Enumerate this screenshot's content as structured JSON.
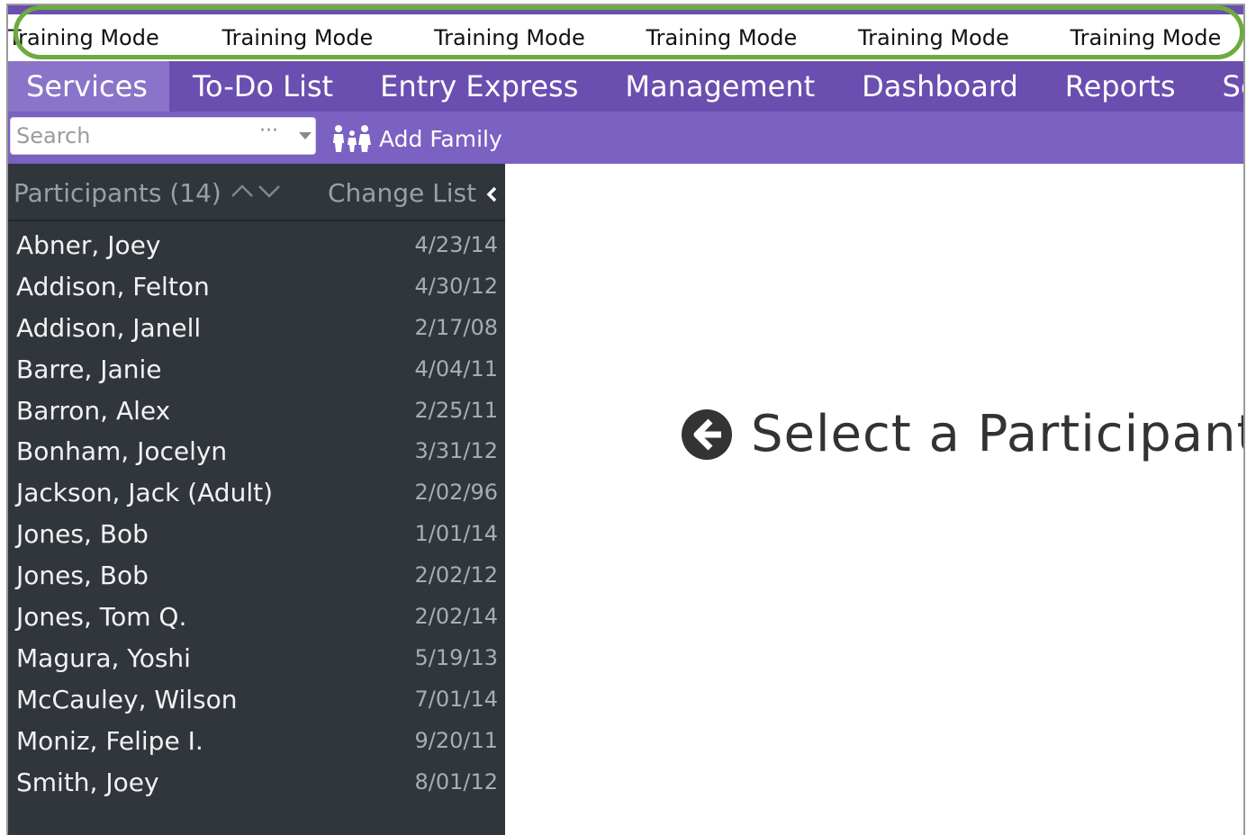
{
  "training_bar": {
    "items": [
      "Training Mode",
      "Training Mode",
      "Training Mode",
      "Training Mode",
      "Training Mode",
      "Training Mode"
    ],
    "highlight_color": "#6cab3c"
  },
  "nav": {
    "tabs": [
      {
        "label": "Services",
        "active": true
      },
      {
        "label": "To-Do List",
        "active": false
      },
      {
        "label": "Entry Express",
        "active": false
      },
      {
        "label": "Management",
        "active": false
      },
      {
        "label": "Dashboard",
        "active": false
      },
      {
        "label": "Reports",
        "active": false
      },
      {
        "label": "Setup",
        "active": false
      }
    ]
  },
  "toolbar": {
    "search_placeholder": "Search",
    "search_dots": "···",
    "add_family_label": "Add Family"
  },
  "sidebar": {
    "participants_label": "Participants (14)",
    "change_list_label": "Change List",
    "participants": [
      {
        "name": "Abner, Joey",
        "date": "4/23/14"
      },
      {
        "name": "Addison, Felton",
        "date": "4/30/12"
      },
      {
        "name": "Addison, Janell",
        "date": "2/17/08"
      },
      {
        "name": "Barre, Janie",
        "date": "4/04/11"
      },
      {
        "name": "Barron, Alex",
        "date": "2/25/11"
      },
      {
        "name": "Bonham, Jocelyn",
        "date": "3/31/12"
      },
      {
        "name": "Jackson, Jack (Adult)",
        "date": "2/02/96"
      },
      {
        "name": "Jones, Bob",
        "date": "1/01/14"
      },
      {
        "name": "Jones, Bob",
        "date": "2/02/12"
      },
      {
        "name": "Jones, Tom Q.",
        "date": "2/02/14"
      },
      {
        "name": "Magura, Yoshi",
        "date": "5/19/13"
      },
      {
        "name": "McCauley, Wilson",
        "date": "7/01/14"
      },
      {
        "name": "Moniz, Felipe I.",
        "date": "9/20/11"
      },
      {
        "name": "Smith, Joey",
        "date": "8/01/12"
      }
    ]
  },
  "main": {
    "prompt": "Select a Participant"
  },
  "colors": {
    "nav_bg": "#6a4fb0",
    "nav_active": "#8a74c9",
    "toolbar_bg": "#7a61c2",
    "sidebar_bg": "#31363d"
  }
}
